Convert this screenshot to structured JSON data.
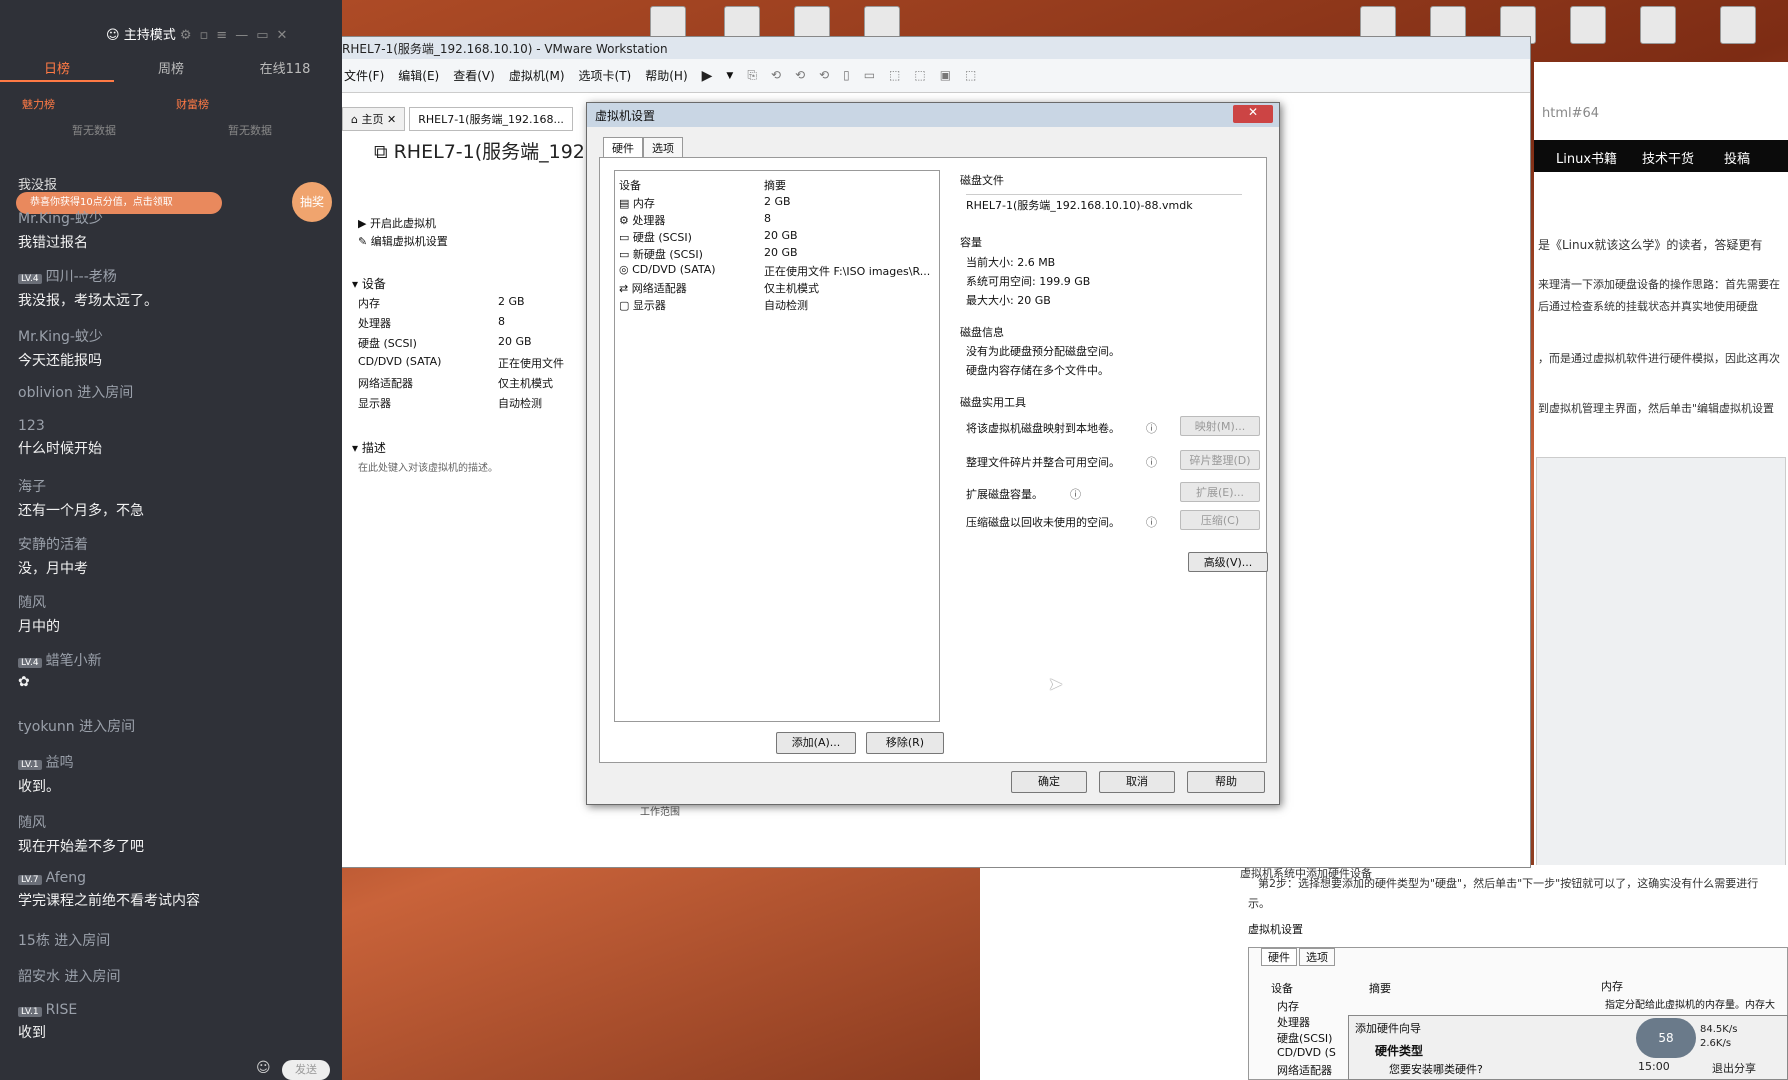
{
  "chat": {
    "header": {
      "title": "主持模式"
    },
    "tabs": [
      "日榜",
      "周榜",
      "在线118"
    ],
    "subtabs": [
      "魅力榜",
      "财富榜"
    ],
    "empty": [
      "暂无数据",
      "暂无数据"
    ],
    "banner": "我没报",
    "promo": "恭喜你获得10点分值，点击领取",
    "lottery": "抽奖",
    "messages": [
      {
        "name": "Mr.King-蚊少",
        "text": "我错过报名",
        "lv": ""
      },
      {
        "name": "四川---老杨",
        "text": "我没报，考场太远了。",
        "lv": "LV.4"
      },
      {
        "name": "Mr.King-蚊少",
        "text": "今天还能报吗",
        "lv": ""
      },
      {
        "name": "oblivion 进入房间",
        "text": "",
        "lv": ""
      },
      {
        "name": "123",
        "text": "什么时候开始",
        "lv": ""
      },
      {
        "name": "海子",
        "text": "还有一个月多，不急",
        "lv": ""
      },
      {
        "name": "安静的活着",
        "text": "没，月中考",
        "lv": ""
      },
      {
        "name": "随风",
        "text": "月中的",
        "lv": ""
      },
      {
        "name": "蜡笔小新",
        "text": "",
        "lv": "LV.4"
      },
      {
        "name": "tyokunn 进入房间",
        "text": "",
        "lv": ""
      },
      {
        "name": "益鸣",
        "text": "收到。",
        "lv": "LV.1"
      },
      {
        "name": "随风",
        "text": "现在开始差不多了吧",
        "lv": ""
      },
      {
        "name": "Afeng",
        "text": "学完课程之前绝不看考试内容",
        "lv": "LV.7"
      },
      {
        "name": "15栋 进入房间",
        "text": "",
        "lv": ""
      },
      {
        "name": "韶安水 进入房间",
        "text": "",
        "lv": ""
      },
      {
        "name": "RISE",
        "text": "收到",
        "lv": "LV.1"
      }
    ],
    "send": "发送"
  },
  "vmware": {
    "title": "RHEL7-1(服务端_192.168.10.10) - VMware Workstation",
    "menu": [
      "文件(F)",
      "编辑(E)",
      "查看(V)",
      "虚拟机(M)",
      "选项卡(T)",
      "帮助(H)"
    ],
    "tabs": [
      "主页",
      "RHEL7-1(服务端_192.168..."
    ],
    "vm_title": "RHEL7-1(服务端_192.1",
    "actions": [
      "开启此虚拟机",
      "编辑虚拟机设置"
    ],
    "devices_header": "设备",
    "devices": [
      {
        "name": "内存",
        "value": "2 GB"
      },
      {
        "name": "处理器",
        "value": "8"
      },
      {
        "name": "硬盘 (SCSI)",
        "value": "20 GB"
      },
      {
        "name": "CD/DVD (SATA)",
        "value": "正在使用文件"
      },
      {
        "name": "网络适配器",
        "value": "仅主机模式"
      },
      {
        "name": "显示器",
        "value": "自动检测"
      }
    ],
    "desc_header": "描述",
    "desc_hint": "在此处键入对该虚拟机的描述。",
    "behind_text": "工作范围"
  },
  "dialog": {
    "title": "虚拟机设置",
    "tabs": [
      "硬件",
      "选项"
    ],
    "cols": [
      "设备",
      "摘要"
    ],
    "rows": [
      {
        "device": "内存",
        "summary": "2 GB"
      },
      {
        "device": "处理器",
        "summary": "8"
      },
      {
        "device": "硬盘 (SCSI)",
        "summary": "20 GB"
      },
      {
        "device": "新硬盘 (SCSI)",
        "summary": "20 GB"
      },
      {
        "device": "CD/DVD (SATA)",
        "summary": "正在使用文件 F:\\ISO images\\R..."
      },
      {
        "device": "网络适配器",
        "summary": "仅主机模式"
      },
      {
        "device": "显示器",
        "summary": "自动检测"
      }
    ],
    "add_btn": "添加(A)...",
    "remove_btn": "移除(R)",
    "disk_file_h": "磁盘文件",
    "disk_file": "RHEL7-1(服务端_192.168.10.10)-88.vmdk",
    "capacity_h": "容量",
    "cur_size": "当前大小: 2.6 MB",
    "sys_free": "系统可用空间: 199.9 GB",
    "max_size": "最大大小: 20 GB",
    "disk_info_h": "磁盘信息",
    "info1": "没有为此硬盘预分配磁盘空间。",
    "info2": "硬盘内容存储在多个文件中。",
    "tools_h": "磁盘实用工具",
    "tools": [
      {
        "label": "将该虚拟机磁盘映射到本地卷。",
        "btn": "映射(M)..."
      },
      {
        "label": "整理文件碎片并整合可用空间。",
        "btn": "碎片整理(D)"
      },
      {
        "label": "扩展磁盘容量。",
        "btn": "扩展(E)..."
      },
      {
        "label": "压缩磁盘以回收未使用的空间。",
        "btn": "压缩(C)"
      }
    ],
    "advanced": "高级(V)...",
    "ok": "确定",
    "cancel": "取消",
    "help": "帮助"
  },
  "web": {
    "url": "html#64",
    "nav": [
      "Linux书籍",
      "技术干货",
      "投稿"
    ],
    "p1": "是《Linux就该这么学》的读者，答疑更有",
    "p2": "来理清一下添加硬盘设备的操作思路：首先需要在",
    "p3": "后通过检查系统的挂载状态并真实地使用硬盘",
    "p4": "，而是通过虚拟机软件进行硬件模拟，因此这再次",
    "p5": "到虚拟机管理主界面，然后单击\"编辑虚拟机设置",
    "caption": "虚拟机系统中添加硬件设备",
    "step2": "第2步：选择想要添加的硬件类型为\"硬盘\"，然后单击\"下一步\"按钮就可以了，这确实没有什么需要进行",
    "step2b": "示。",
    "doc_title": "虚拟机设置",
    "doc_tabs": [
      "硬件",
      "选项"
    ],
    "doc_cols": [
      "设备",
      "摘要",
      "内存"
    ],
    "doc_rows": [
      "内存",
      "处理器",
      "硬盘(SCSI)",
      "CD/DVD (S",
      "网络适配器"
    ],
    "doc_mem_hint": "指定分配给此虚拟机的内存量。内存大",
    "wizard_title": "添加硬件向导",
    "wizard_h": "硬件类型",
    "wizard_q": "您要安装哪类硬件?",
    "net_down": "84.5K/s",
    "net_up": "2.6K/s",
    "net_pct": "58",
    "share": "退出分享",
    "time": "15:00"
  }
}
